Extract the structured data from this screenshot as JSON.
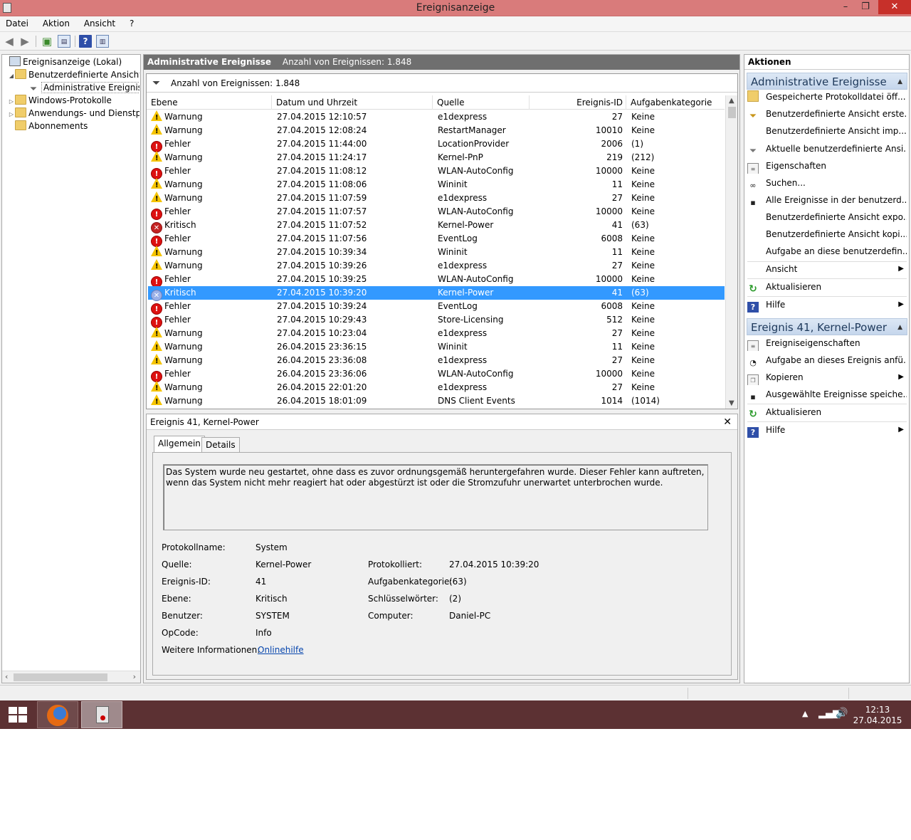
{
  "window": {
    "title": "Ereignisanzeige"
  },
  "menu": [
    "Datei",
    "Aktion",
    "Ansicht",
    "?"
  ],
  "tree": [
    {
      "label": "Ereignisanzeige (Lokal)"
    },
    {
      "label": "Benutzerdefinierte Ansichten"
    },
    {
      "label": "Administrative Ereignisse"
    },
    {
      "label": "Windows-Protokolle"
    },
    {
      "label": "Anwendungs- und Dienstprotokolle"
    },
    {
      "label": "Abonnements"
    }
  ],
  "center": {
    "header_title": "Administrative Ereignisse",
    "header_count": "Anzahl von Ereignissen: 1.848",
    "count_text": "Anzahl von Ereignissen: 1.848",
    "columns": [
      "Ebene",
      "Datum und Uhrzeit",
      "Quelle",
      "Ereignis-ID",
      "Aufgabenkategorie"
    ]
  },
  "events": [
    {
      "level": "Warnung",
      "type": "w",
      "date": "27.04.2015 12:10:57",
      "source": "e1dexpress",
      "id": "27",
      "cat": "Keine"
    },
    {
      "level": "Warnung",
      "type": "w",
      "date": "27.04.2015 12:08:24",
      "source": "RestartManager",
      "id": "10010",
      "cat": "Keine"
    },
    {
      "level": "Fehler",
      "type": "e",
      "date": "27.04.2015 11:44:00",
      "source": "LocationProvider",
      "id": "2006",
      "cat": "(1)"
    },
    {
      "level": "Warnung",
      "type": "w",
      "date": "27.04.2015 11:24:17",
      "source": "Kernel-PnP",
      "id": "219",
      "cat": "(212)"
    },
    {
      "level": "Fehler",
      "type": "e",
      "date": "27.04.2015 11:08:12",
      "source": "WLAN-AutoConfig",
      "id": "10000",
      "cat": "Keine"
    },
    {
      "level": "Warnung",
      "type": "w",
      "date": "27.04.2015 11:08:06",
      "source": "Wininit",
      "id": "11",
      "cat": "Keine"
    },
    {
      "level": "Warnung",
      "type": "w",
      "date": "27.04.2015 11:07:59",
      "source": "e1dexpress",
      "id": "27",
      "cat": "Keine"
    },
    {
      "level": "Fehler",
      "type": "e",
      "date": "27.04.2015 11:07:57",
      "source": "WLAN-AutoConfig",
      "id": "10000",
      "cat": "Keine"
    },
    {
      "level": "Kritisch",
      "type": "k",
      "date": "27.04.2015 11:07:52",
      "source": "Kernel-Power",
      "id": "41",
      "cat": "(63)"
    },
    {
      "level": "Fehler",
      "type": "e",
      "date": "27.04.2015 11:07:56",
      "source": "EventLog",
      "id": "6008",
      "cat": "Keine"
    },
    {
      "level": "Warnung",
      "type": "w",
      "date": "27.04.2015 10:39:34",
      "source": "Wininit",
      "id": "11",
      "cat": "Keine"
    },
    {
      "level": "Warnung",
      "type": "w",
      "date": "27.04.2015 10:39:26",
      "source": "e1dexpress",
      "id": "27",
      "cat": "Keine"
    },
    {
      "level": "Fehler",
      "type": "e",
      "date": "27.04.2015 10:39:25",
      "source": "WLAN-AutoConfig",
      "id": "10000",
      "cat": "Keine"
    },
    {
      "level": "Kritisch",
      "type": "k",
      "date": "27.04.2015 10:39:20",
      "source": "Kernel-Power",
      "id": "41",
      "cat": "(63)",
      "selected": true
    },
    {
      "level": "Fehler",
      "type": "e",
      "date": "27.04.2015 10:39:24",
      "source": "EventLog",
      "id": "6008",
      "cat": "Keine"
    },
    {
      "level": "Fehler",
      "type": "e",
      "date": "27.04.2015 10:29:43",
      "source": "Store-Licensing",
      "id": "512",
      "cat": "Keine"
    },
    {
      "level": "Warnung",
      "type": "w",
      "date": "27.04.2015 10:23:04",
      "source": "e1dexpress",
      "id": "27",
      "cat": "Keine"
    },
    {
      "level": "Warnung",
      "type": "w",
      "date": "26.04.2015 23:36:15",
      "source": "Wininit",
      "id": "11",
      "cat": "Keine"
    },
    {
      "level": "Warnung",
      "type": "w",
      "date": "26.04.2015 23:36:08",
      "source": "e1dexpress",
      "id": "27",
      "cat": "Keine"
    },
    {
      "level": "Fehler",
      "type": "e",
      "date": "26.04.2015 23:36:06",
      "source": "WLAN-AutoConfig",
      "id": "10000",
      "cat": "Keine"
    },
    {
      "level": "Warnung",
      "type": "w",
      "date": "26.04.2015 22:01:20",
      "source": "e1dexpress",
      "id": "27",
      "cat": "Keine"
    },
    {
      "level": "Warnung",
      "type": "w",
      "date": "26.04.2015 18:01:09",
      "source": "DNS Client Events",
      "id": "1014",
      "cat": "(1014)"
    }
  ],
  "detail": {
    "title": "Ereignis 41, Kernel-Power",
    "tabs": [
      "Allgemein",
      "Details"
    ],
    "description": "Das System wurde neu gestartet, ohne dass es zuvor ordnungsgemäß heruntergefahren wurde. Dieser Fehler kann auftreten, wenn das System nicht mehr reagiert hat oder abgestürzt ist oder die Stromzufuhr unerwartet unterbrochen wurde.",
    "props": {
      "protokollname_label": "Protokollname:",
      "protokollname": "System",
      "quelle_label": "Quelle:",
      "quelle": "Kernel-Power",
      "protokolliert_label": "Protokolliert:",
      "protokolliert": "27.04.2015 10:39:20",
      "id_label": "Ereignis-ID:",
      "id": "41",
      "kategorie_label": "Aufgabenkategorie:",
      "kategorie": "(63)",
      "ebene_label": "Ebene:",
      "ebene": "Kritisch",
      "schluessel_label": "Schlüsselwörter:",
      "schluessel": "(2)",
      "benutzer_label": "Benutzer:",
      "benutzer": "SYSTEM",
      "computer_label": "Computer:",
      "computer": "Daniel-PC",
      "opcode_label": "OpCode:",
      "opcode": "Info",
      "info_label": "Weitere Informationen:",
      "info_link": "Onlinehilfe"
    }
  },
  "actions": {
    "title": "Aktionen",
    "section1": "Administrative Ereignisse",
    "items1": [
      "Gespeicherte Protokolldatei öff...",
      "Benutzerdefinierte Ansicht erste...",
      "Benutzerdefinierte Ansicht imp...",
      "Aktuelle benutzerdefinierte Ansi...",
      "Eigenschaften",
      "Suchen...",
      "Alle Ereignisse in der benutzerd...",
      "Benutzerdefinierte Ansicht expo...",
      "Benutzerdefinierte Ansicht kopi...",
      "Aufgabe an diese benutzerdefin...",
      "Ansicht",
      "Aktualisieren",
      "Hilfe"
    ],
    "section2": "Ereignis 41, Kernel-Power",
    "items2": [
      "Ereigniseigenschaften",
      "Aufgabe an dieses Ereignis anfü...",
      "Kopieren",
      "Ausgewählte Ereignisse speiche...",
      "Aktualisieren",
      "Hilfe"
    ]
  },
  "taskbar": {
    "time": "12:13",
    "date": "27.04.2015"
  }
}
